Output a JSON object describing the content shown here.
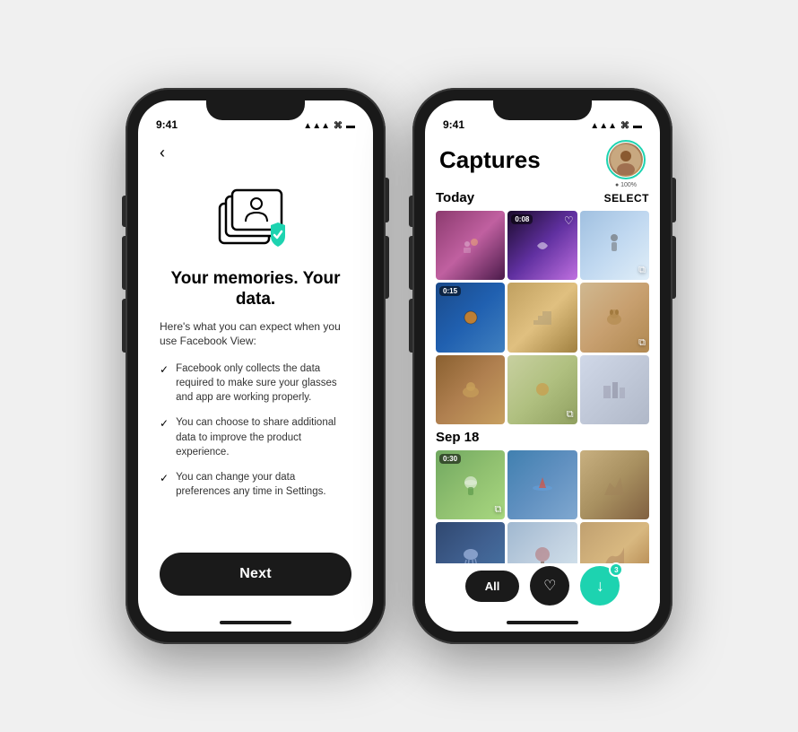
{
  "left_phone": {
    "status": {
      "time": "9:41",
      "signal": "▲▲▲",
      "wifi": "WiFi",
      "battery": "■"
    },
    "back_label": "‹",
    "heading": "Your memories. Your data.",
    "subtext": "Here's what you can expect when you use Facebook View:",
    "bullets": [
      "Facebook only collects the data required to make sure your glasses and app are working properly.",
      "You can choose to share additional data to improve the product experience.",
      "You can change your data preferences any time in Settings."
    ],
    "next_button": "Next"
  },
  "right_phone": {
    "status": {
      "time": "9:41",
      "signal": "▲▲▲",
      "wifi": "WiFi",
      "battery": "■"
    },
    "title": "Captures",
    "avatar_pct": "● 100%",
    "sections": [
      {
        "label": "Today",
        "select_label": "SELECT",
        "thumbs": [
          {
            "class": "t1",
            "duration": null,
            "heart": true,
            "copy": false
          },
          {
            "class": "t2",
            "duration": "0:08",
            "heart": true,
            "copy": false
          },
          {
            "class": "t3",
            "duration": null,
            "heart": false,
            "copy": true
          },
          {
            "class": "t4",
            "duration": "0:15",
            "heart": false,
            "copy": false
          },
          {
            "class": "t5",
            "duration": null,
            "heart": false,
            "copy": false
          },
          {
            "class": "t6",
            "duration": null,
            "heart": false,
            "copy": true
          },
          {
            "class": "t7",
            "duration": null,
            "heart": false,
            "copy": false
          },
          {
            "class": "t8",
            "duration": null,
            "heart": false,
            "copy": true
          },
          {
            "class": "t9",
            "duration": null,
            "heart": false,
            "copy": false
          }
        ]
      },
      {
        "label": "Sep 18",
        "select_label": "",
        "thumbs": [
          {
            "class": "t10",
            "duration": "0:30",
            "heart": false,
            "copy": true
          },
          {
            "class": "t11",
            "duration": null,
            "heart": false,
            "copy": false
          },
          {
            "class": "t12",
            "duration": null,
            "heart": false,
            "copy": false
          },
          {
            "class": "t13",
            "duration": null,
            "heart": false,
            "copy": false
          },
          {
            "class": "t14",
            "duration": null,
            "heart": false,
            "copy": false
          },
          {
            "class": "t15",
            "duration": null,
            "heart": false,
            "copy": false
          }
        ]
      }
    ],
    "nav": {
      "all_label": "All",
      "heart_icon": "♡",
      "download_icon": "↓",
      "download_badge": "3"
    }
  }
}
